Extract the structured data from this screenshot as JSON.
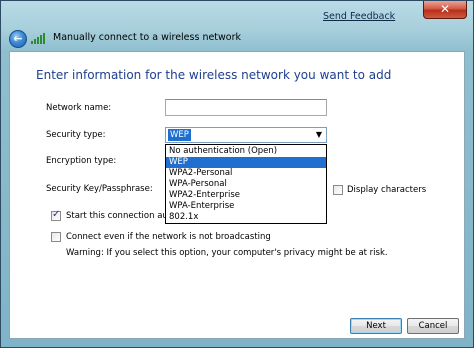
{
  "titlebar": {
    "send_feedback": "Send Feedback",
    "close_glyph": "✕",
    "back_glyph": "←",
    "title": "Manually connect to a wireless network"
  },
  "content": {
    "heading": "Enter information for the wireless network you want to add",
    "network_name": {
      "label": "Network name:",
      "value": ""
    },
    "security_type": {
      "label": "Security type:",
      "selected": "WEP",
      "options": [
        "No authentication (Open)",
        "WEP",
        "WPA2-Personal",
        "WPA-Personal",
        "WPA2-Enterprise",
        "WPA-Enterprise",
        "802.1x"
      ]
    },
    "encryption_type": {
      "label": "Encryption type:"
    },
    "security_key": {
      "label": "Security Key/Passphrase:",
      "value": ""
    },
    "display_characters": {
      "label": "Display characters",
      "checked": false
    },
    "start_automatically": {
      "label": "Start this connection auto",
      "checked": true
    },
    "connect_hidden": {
      "label": "Connect even if the network is not broadcasting",
      "checked": false
    },
    "warning": "Warning: If you select this option, your computer's privacy might be at risk."
  },
  "footer": {
    "next_label": "Next",
    "cancel_label": "Cancel"
  }
}
